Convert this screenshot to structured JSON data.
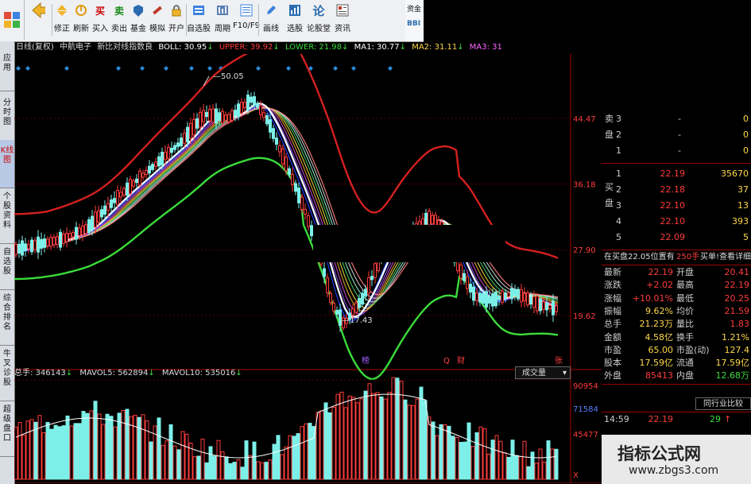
{
  "toolbar": {
    "buttons": [
      {
        "label": "修正",
        "icon": "refresh-icon"
      },
      {
        "label": "刷新",
        "icon": "reload-icon"
      },
      {
        "label": "买入",
        "icon": "buy-icon",
        "glyph": "买"
      },
      {
        "label": "卖出",
        "icon": "sell-icon",
        "glyph": "卖"
      },
      {
        "label": "基金",
        "icon": "fund-icon"
      },
      {
        "label": "模拟",
        "icon": "simulate-icon"
      },
      {
        "label": "开户",
        "icon": "lock-icon"
      },
      {
        "label": "自选股",
        "icon": "watchlist-icon"
      },
      {
        "label": "周期",
        "icon": "period-icon"
      },
      {
        "label": "F10/F9",
        "icon": "f10-icon"
      },
      {
        "label": "画线",
        "icon": "pen-icon"
      },
      {
        "label": "选股",
        "icon": "select-stock-icon"
      },
      {
        "label": "论股堂",
        "icon": "forum-icon",
        "glyph": "论"
      },
      {
        "label": "资讯",
        "icon": "news-icon"
      }
    ],
    "edge_text": "资金",
    "edge_text2": "BBI"
  },
  "sidebar": {
    "items": [
      "应用",
      "分时图",
      "K线图",
      "个股资料",
      "自选股",
      "综合排名",
      "牛叉诊股",
      "超级盘口"
    ]
  },
  "infobar": {
    "period": "日线(复权)",
    "stock": "中航电子",
    "hint": "新比对线指数良",
    "boll": "BOLL: 30.95",
    "boll_arrow": "↓",
    "upper": "UPPER: 39.92",
    "upper_arrow": "↓",
    "lower": "LOWER: 21.98",
    "lower_arrow": "↓",
    "ma1": "MA1: 30.77",
    "ma1_arrow": "↓",
    "ma2": "MA2: 31.11",
    "ma2_arrow": "↓",
    "ma3": "MA3: 31"
  },
  "chart_data": {
    "type": "candlestick",
    "price_axis_labels": [
      "44.47",
      "36.18",
      "27.90",
      "19.62"
    ],
    "price_levels": [
      44.47,
      36.18,
      27.9,
      19.62
    ],
    "high_label": "50.05",
    "low_label": "17.43",
    "event_markers": [
      "榜",
      "Q",
      "财",
      "张"
    ],
    "colors": {
      "up": "#ff3c3c",
      "down": "#7cf0e8",
      "upper": "#d42020",
      "lower": "#3adc3a",
      "mid": "#ffffff"
    }
  },
  "volume": {
    "total": "总手: 346143",
    "total_arrow": "↓",
    "mavol5": "MAVOL5: 562894",
    "mavol5_arrow": "↓",
    "mavol10": "MAVOL10: 535016",
    "mavol10_arrow": "↓",
    "selector": "成交量",
    "axis_labels": [
      "90954",
      "71584",
      "45477"
    ],
    "axis_unit": "X"
  },
  "order_book": {
    "sell_label": "卖盘",
    "buy_label": "买盘",
    "sell_rows": [
      {
        "level": "3",
        "price": "-",
        "vol": "0"
      },
      {
        "level": "2",
        "price": "-",
        "vol": "0"
      },
      {
        "level": "1",
        "price": "-",
        "vol": "0"
      }
    ],
    "buy_rows": [
      {
        "level": "1",
        "price": "22.19",
        "vol": "35670"
      },
      {
        "level": "2",
        "price": "22.18",
        "vol": "37"
      },
      {
        "level": "3",
        "price": "22.10",
        "vol": "13"
      },
      {
        "level": "4",
        "price": "22.10",
        "vol": "393"
      },
      {
        "level": "5",
        "price": "22.09",
        "vol": "5"
      }
    ],
    "status_line": "在买盘22.05位置有",
    "status_qty": "250手",
    "status_link": "买单!查看详细"
  },
  "stats": [
    {
      "l1": "最新",
      "v1": "22.19",
      "c1": "#ff3c3c",
      "l2": "开盘",
      "v2": "20.41",
      "c2": "#ff3c3c"
    },
    {
      "l1": "涨跌",
      "v1": "+2.02",
      "c1": "#ff3c3c",
      "l2": "最高",
      "v2": "22.19",
      "c2": "#ff3c3c"
    },
    {
      "l1": "涨幅",
      "v1": "+10.01%",
      "c1": "#ff3c3c",
      "l2": "最低",
      "v2": "20.25",
      "c2": "#ff3c3c"
    },
    {
      "l1": "振幅",
      "v1": "9.62%",
      "c1": "#ffd84a",
      "l2": "均价",
      "v2": "21.59",
      "c2": "#ff3c3c"
    },
    {
      "l1": "总手",
      "v1": "21.23万",
      "c1": "#ffd84a",
      "l2": "量比",
      "v2": "1.83",
      "c2": "#ff3c3c"
    },
    {
      "l1": "金额",
      "v1": "4.58亿",
      "c1": "#ffd84a",
      "l2": "换手",
      "v2": "1.21%",
      "c2": "#ffd84a"
    },
    {
      "l1": "市盈",
      "v1": "65.00",
      "c1": "#ffd84a",
      "l2": "市盈(动)",
      "v2": "127.4",
      "c2": "#ffd84a"
    },
    {
      "l1": "股本",
      "v1": "17.59亿",
      "c1": "#ffd84a",
      "l2": "流通",
      "v2": "17.59亿",
      "c2": "#ffd84a"
    },
    {
      "l1": "外盘",
      "v1": "85413",
      "c1": "#ff3c3c",
      "l2": "内盘",
      "v2": "12.68万",
      "c2": "#3adc3a"
    }
  ],
  "compare_button": "同行业比较",
  "tick": {
    "time": "14:59",
    "price": "22.19",
    "vol": "29",
    "arrow": "↑"
  },
  "watermark": {
    "title": "指标公式网",
    "url": "www.zbgs3.com"
  }
}
